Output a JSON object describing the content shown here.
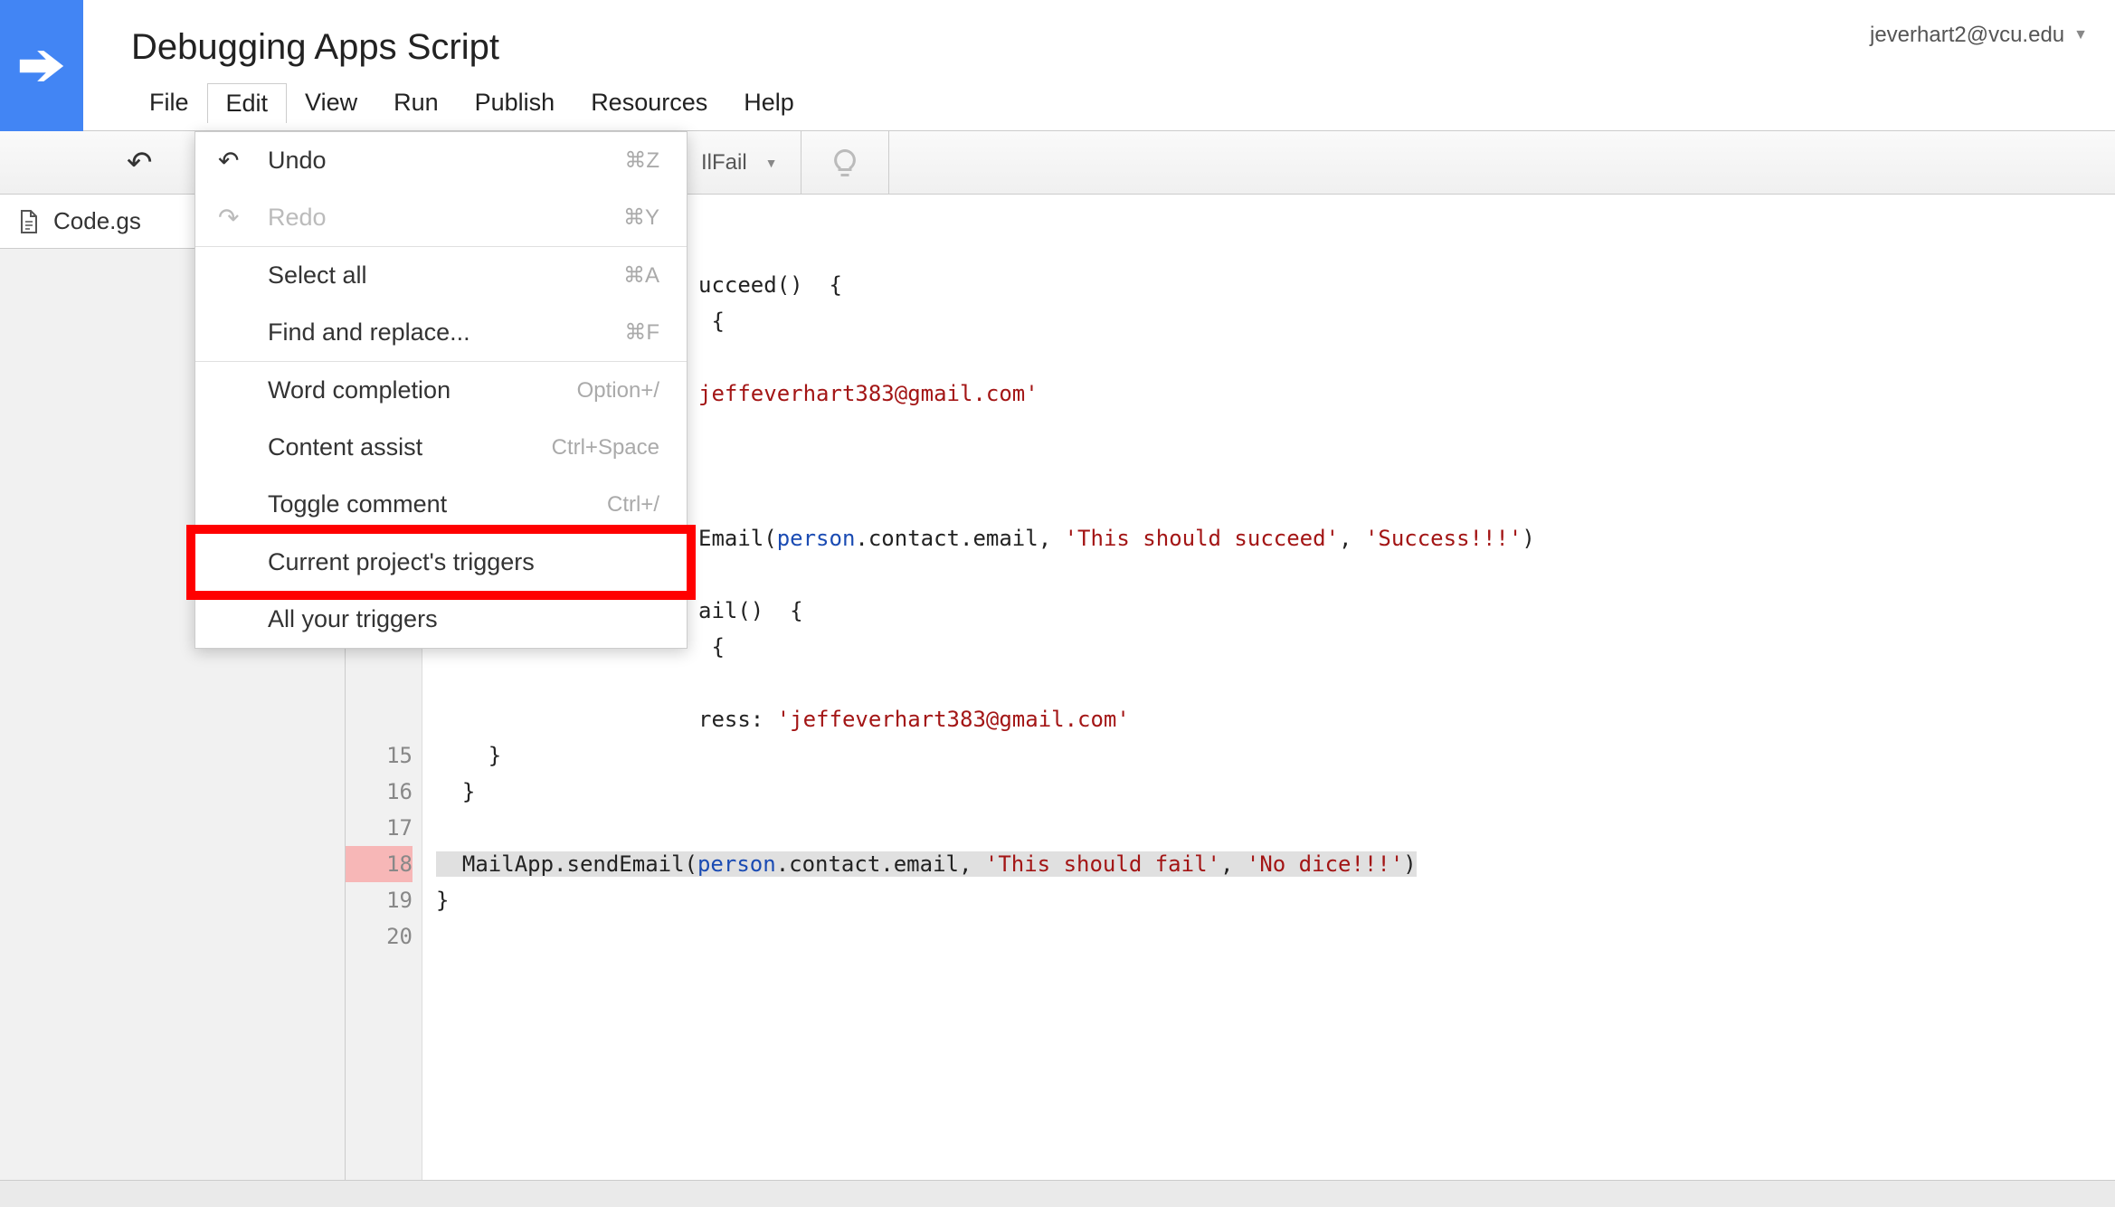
{
  "title": "Debugging Apps Script",
  "user_email": "jeverhart2@vcu.edu",
  "menubar": {
    "file": "File",
    "edit": "Edit",
    "view": "View",
    "run": "Run",
    "publish": "Publish",
    "resources": "Resources",
    "help": "Help"
  },
  "toolbar": {
    "function_selected": "IlFail"
  },
  "sidebar": {
    "file": "Code.gs"
  },
  "edit_menu": {
    "undo": {
      "label": "Undo",
      "shortcut": "⌘Z"
    },
    "redo": {
      "label": "Redo",
      "shortcut": "⌘Y"
    },
    "select_all": {
      "label": "Select all",
      "shortcut": "⌘A"
    },
    "find_replace": {
      "label": "Find and replace...",
      "shortcut": "⌘F"
    },
    "word_completion": {
      "label": "Word completion",
      "shortcut": "Option+/"
    },
    "content_assist": {
      "label": "Content assist",
      "shortcut": "Ctrl+Space"
    },
    "toggle_comment": {
      "label": "Toggle comment",
      "shortcut": "Ctrl+/"
    },
    "current_triggers": {
      "label": "Current project's triggers"
    },
    "all_triggers": {
      "label": "All your triggers"
    }
  },
  "code": {
    "l1": "ucceed()  {",
    "l2": " {",
    "l4a": "jeffeverhart383@gmail.com",
    "l4b": "'",
    "l8a": "Email(",
    "l8b": "person",
    "l8c": ".contact.email, ",
    "l8d": "'This should succeed'",
    "l8e": ", ",
    "l8f": "'Success!!!'",
    "l8g": ")",
    "l10": "ail()  {",
    "l11": " {",
    "l13a": "ress: ",
    "l13b": "'jeffeverhart383@gmail.com'",
    "l14": "    }",
    "l15": "  }",
    "l16": "",
    "l17a": "  MailApp.sendEmail(",
    "l17b": "person",
    "l17c": ".contact.email, ",
    "l17d": "'This should fail'",
    "l17e": ", ",
    "l17f": "'No dice!!!'",
    "l17g": ")",
    "l18": "}",
    "gutter": {
      "g15": "15",
      "g16": "16",
      "g17": "17",
      "g18": "18",
      "g19": "19",
      "g20": "20"
    }
  }
}
